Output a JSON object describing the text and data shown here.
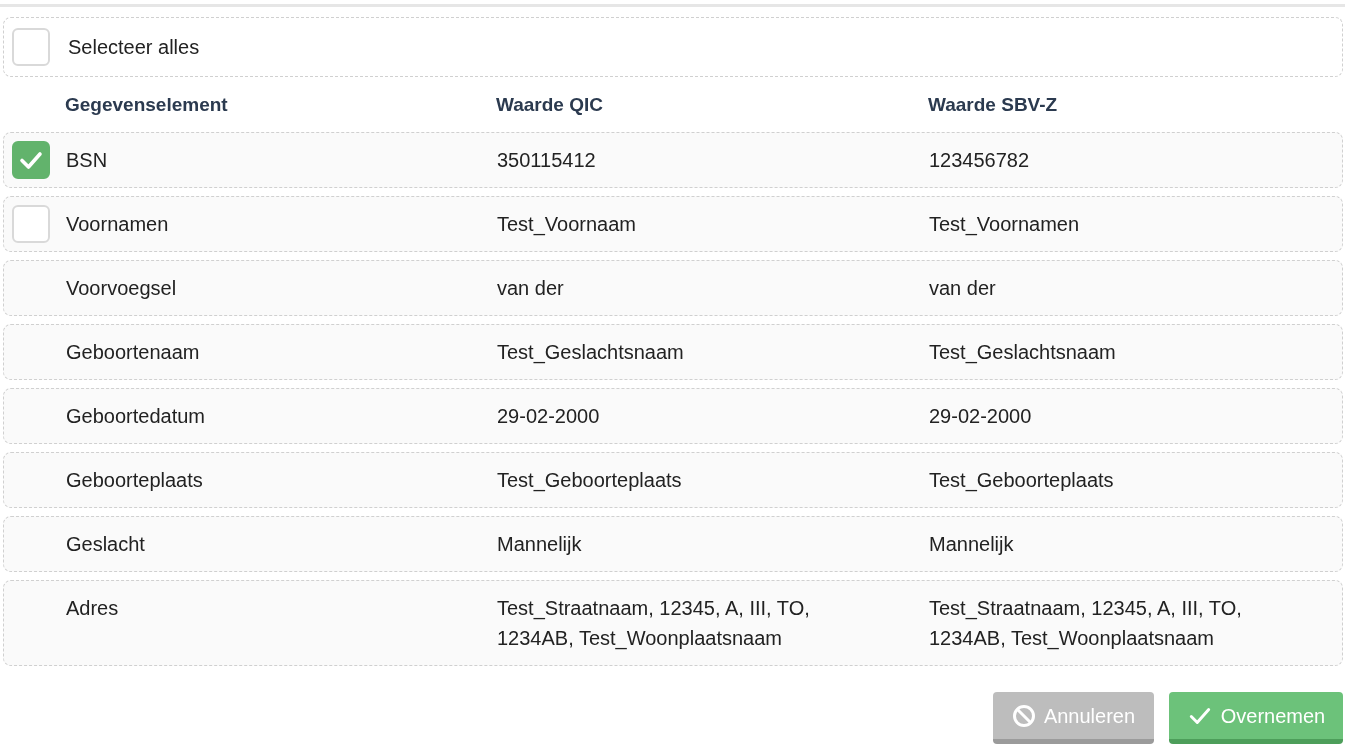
{
  "select_all": {
    "label": "Selecteer alles",
    "checked": false
  },
  "table": {
    "columns": [
      "Gegevenselement",
      "Waarde QIC",
      "Waarde SBV-Z"
    ],
    "rows": [
      {
        "kind": "selectable",
        "checked": true,
        "cells": [
          "BSN",
          "350115412",
          "123456782"
        ]
      },
      {
        "kind": "selectable",
        "checked": false,
        "cells": [
          "Voornamen",
          "Test_Voornaam",
          "Test_Voornamen"
        ]
      },
      {
        "kind": "plain",
        "cells": [
          "Voorvoegsel",
          "van der",
          "van der"
        ]
      },
      {
        "kind": "plain",
        "cells": [
          "Geboortenaam",
          "Test_Geslachtsnaam",
          "Test_Geslachtsnaam"
        ]
      },
      {
        "kind": "plain",
        "cells": [
          "Geboortedatum",
          "29-02-2000",
          "29-02-2000"
        ]
      },
      {
        "kind": "plain",
        "cells": [
          "Geboorteplaats",
          "Test_Geboorteplaats",
          "Test_Geboorteplaats"
        ]
      },
      {
        "kind": "plain",
        "cells": [
          "Geslacht",
          "Mannelijk",
          "Mannelijk"
        ]
      },
      {
        "kind": "plain",
        "cells": [
          "Adres",
          "Test_Straatnaam, 12345, A, III, TO, 1234AB, Test_Woonplaatsnaam",
          "Test_Straatnaam, 12345, A, III, TO, 1234AB, Test_Woonplaatsnaam"
        ]
      }
    ]
  },
  "buttons": [
    {
      "kind": "cancel",
      "label": "Annuleren"
    },
    {
      "kind": "confirm",
      "label": "Overnemen"
    }
  ]
}
